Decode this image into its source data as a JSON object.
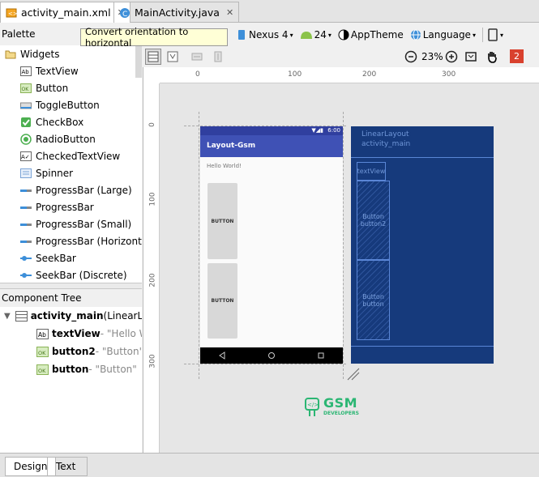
{
  "editor_tabs": [
    {
      "label": "activity_main.xml",
      "active": true
    },
    {
      "label": "MainActivity.java",
      "active": false
    }
  ],
  "palette": {
    "title": "Palette",
    "category": "Widgets",
    "items": [
      "TextView",
      "Button",
      "ToggleButton",
      "CheckBox",
      "RadioButton",
      "CheckedTextView",
      "Spinner",
      "ProgressBar (Large)",
      "ProgressBar",
      "ProgressBar (Small)",
      "ProgressBar (Horizontal)",
      "SeekBar",
      "SeekBar (Discrete)"
    ]
  },
  "toolbar": {
    "tooltip": "Convert orientation to horizontal",
    "device": "Nexus 4",
    "api": "24",
    "theme": "AppTheme",
    "language": "Language",
    "zoom": "23%",
    "error_count": "2"
  },
  "component_tree": {
    "title": "Component Tree",
    "root_id": "activity_main",
    "root_type": " (LinearLay",
    "children": [
      {
        "id": "textView",
        "detail": " - \"Hello W"
      },
      {
        "id": "button2",
        "detail": " - \"Button\""
      },
      {
        "id": "button",
        "detail": " - \"Button\""
      }
    ]
  },
  "rulers": {
    "top": [
      "0",
      "100",
      "200",
      "300"
    ],
    "left": [
      "0",
      "100",
      "200",
      "300"
    ]
  },
  "design_preview": {
    "status_time": "6:00",
    "app_title": "Layout-Gsm",
    "hello_text": "Hello World!",
    "button1": "BUTTON",
    "button2": "BUTTON"
  },
  "blueprint": {
    "layout_label": "LinearLayout",
    "layout_id": "activity_main",
    "textview_label": "textView",
    "b1_label": "Button",
    "b1_id": "button2",
    "b2_label": "Button",
    "b2_id": "button"
  },
  "watermark": {
    "text1": "GSM",
    "text2": "DEVELOPERS"
  },
  "bottom_tabs": [
    {
      "label": "Design",
      "active": true
    },
    {
      "label": "Text",
      "active": false
    }
  ],
  "colors": {
    "primary": "#3f51b5",
    "blueprint_bg": "#163a7c",
    "blueprint_line": "#5a86d6",
    "error_badge": "#d9412e",
    "arrow_red": "#e02020",
    "logo_green": "#2bb673"
  }
}
